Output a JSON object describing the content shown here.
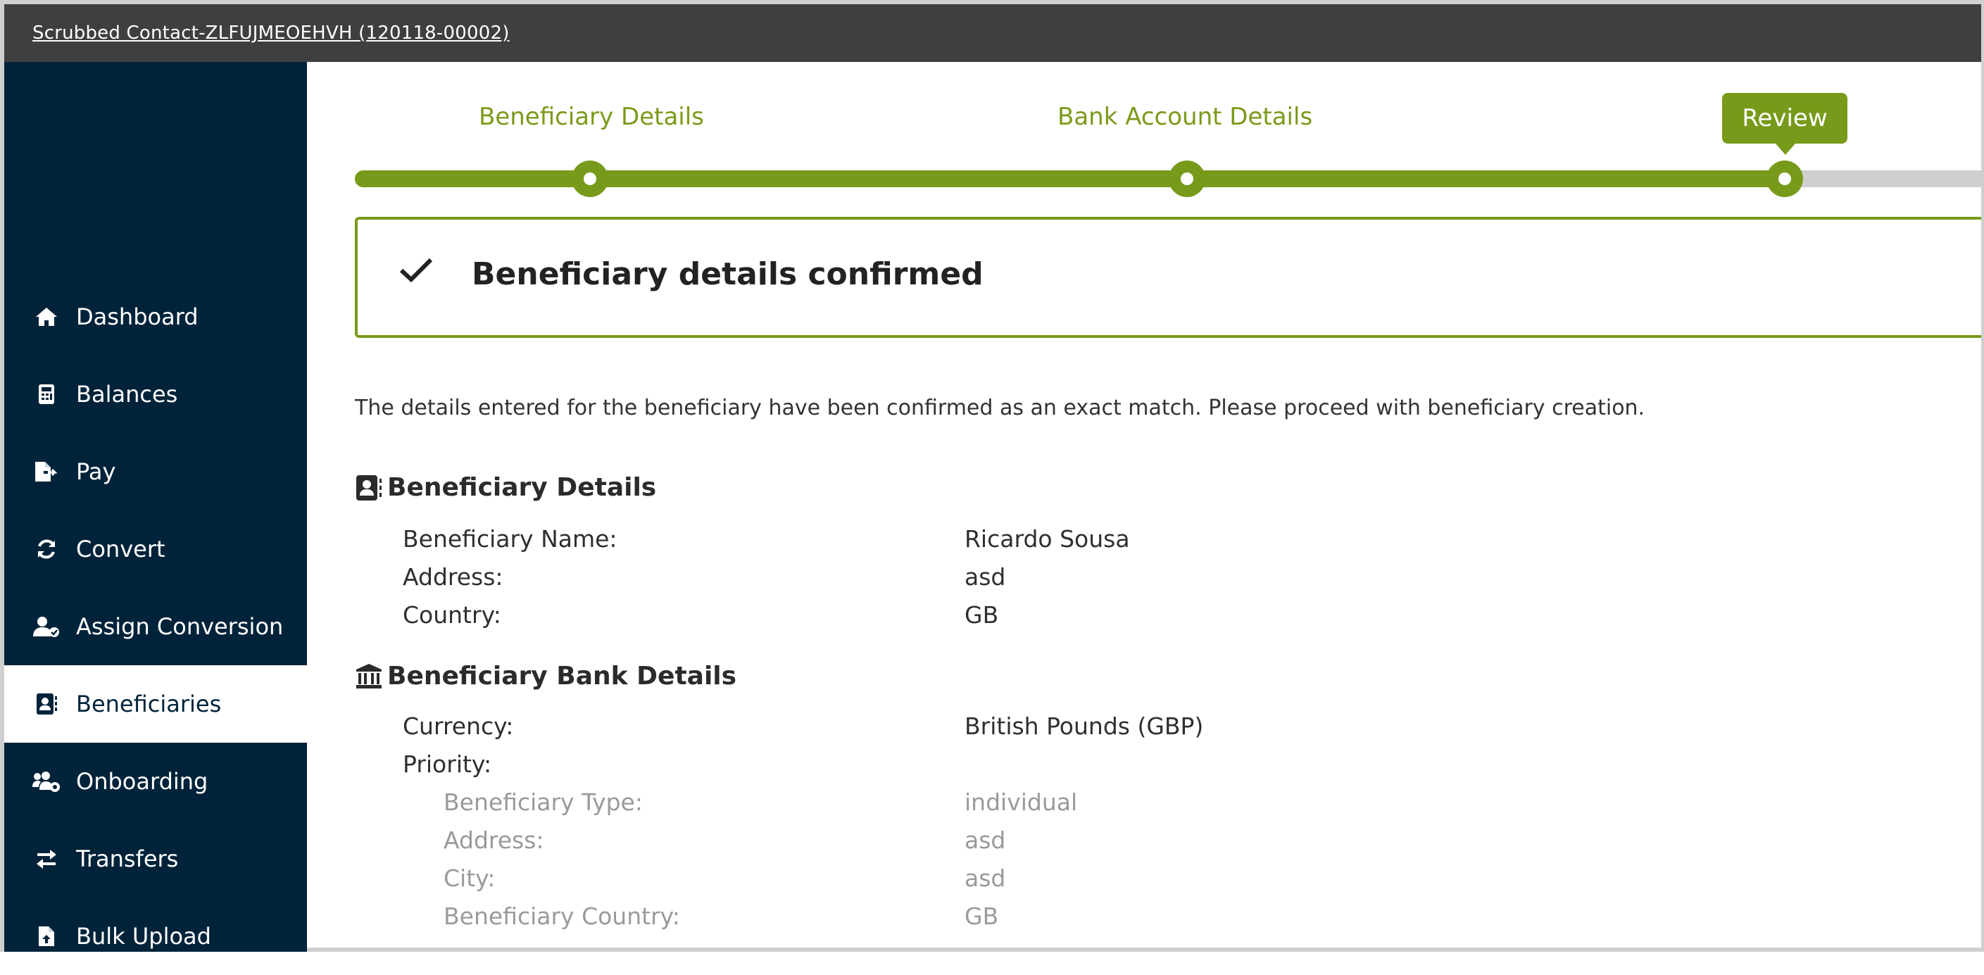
{
  "window": {
    "contact_link": "Scrubbed Contact-ZLFUJMEOEHVH (120118-00002)"
  },
  "sidebar": {
    "items": [
      {
        "label": "Dashboard",
        "icon": "home-icon"
      },
      {
        "label": "Balances",
        "icon": "calculator-icon"
      },
      {
        "label": "Pay",
        "icon": "file-export-icon"
      },
      {
        "label": "Convert",
        "icon": "refresh-icon"
      },
      {
        "label": "Assign Conversion",
        "icon": "user-assign-icon"
      },
      {
        "label": "Beneficiaries",
        "icon": "address-book-icon",
        "active": true
      },
      {
        "label": "Onboarding",
        "icon": "users-cog-icon"
      },
      {
        "label": "Transfers",
        "icon": "exchange-arrows-icon"
      },
      {
        "label": "Bulk Upload",
        "icon": "file-upload-icon"
      }
    ]
  },
  "stepper": {
    "steps": [
      "Beneficiary Details",
      "Bank Account Details",
      "Review"
    ],
    "current_step": "Review",
    "accent": "#789a1a"
  },
  "confirmation": {
    "title": "Beneficiary details confirmed"
  },
  "intro_text": "The details entered for the beneficiary have been confirmed as an exact match. Please proceed with beneficiary creation.",
  "beneficiary_details": {
    "heading": "Beneficiary Details",
    "rows": [
      {
        "label": "Beneficiary Name:",
        "value": "Ricardo Sousa"
      },
      {
        "label": "Address:",
        "value": "asd"
      },
      {
        "label": "Country:",
        "value": "GB"
      }
    ]
  },
  "bank_details": {
    "heading": "Beneficiary Bank Details",
    "rows": [
      {
        "label": "Currency:",
        "value": "British Pounds (GBP)"
      },
      {
        "label": "Priority:",
        "value": ""
      }
    ],
    "sub_rows": [
      {
        "label": "Beneficiary Type:",
        "value": "individual"
      },
      {
        "label": "Address:",
        "value": "asd"
      },
      {
        "label": "City:",
        "value": "asd"
      },
      {
        "label": "Beneficiary Country:",
        "value": "GB"
      }
    ]
  },
  "colors": {
    "sidebar_bg": "#01233a",
    "topbar_bg": "#3f3f41",
    "accent_green": "#789a1a"
  }
}
